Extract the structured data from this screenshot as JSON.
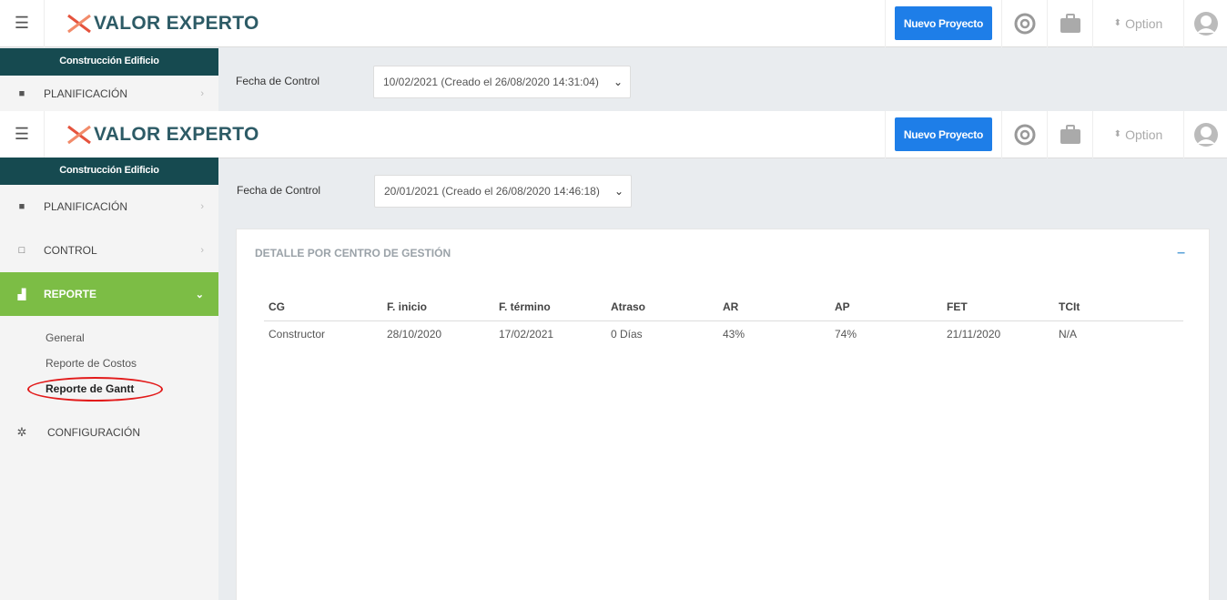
{
  "app": {
    "brand": "VALOR EXPERTO",
    "new_project_label": "Nuevo Proyecto",
    "option_label": "Option",
    "project_name": "Construcción Edificio"
  },
  "background_layer": {
    "nav_item": "PLANIFICACIÓN",
    "filter_label": "Fecha de Control",
    "filter_value": "10/02/2021 (Creado el 26/08/2020 14:31:04)"
  },
  "sidebar": {
    "items": [
      {
        "label": "PLANIFICACIÓN",
        "icon": "book-icon"
      },
      {
        "label": "CONTROL",
        "icon": "clipboard-icon"
      },
      {
        "label": "REPORTE",
        "icon": "chart-icon"
      },
      {
        "label": "CONFIGURACIÓN",
        "icon": "gear-icon"
      }
    ],
    "sub_items": [
      "General",
      "Reporte de Costos",
      "Reporte de Gantt"
    ]
  },
  "filter": {
    "label": "Fecha de Control",
    "value": "20/01/2021 (Creado el 26/08/2020 14:46:18)"
  },
  "card": {
    "title": "DETALLE POR CENTRO DE GESTIÓN",
    "collapse_symbol": "–",
    "columns": [
      "CG",
      "F. inicio",
      "F. término",
      "Atraso",
      "AR",
      "AP",
      "FET",
      "TCIt"
    ],
    "rows": [
      [
        "Constructor",
        "28/10/2020",
        "17/02/2021",
        "0 Días",
        "43%",
        "74%",
        "21/11/2020",
        "N/A"
      ]
    ]
  },
  "colors": {
    "sidebar_header": "#164a50",
    "active_nav": "#7cbd45",
    "primary_button": "#1e7ee8",
    "highlight_ring": "#e21a1a"
  }
}
